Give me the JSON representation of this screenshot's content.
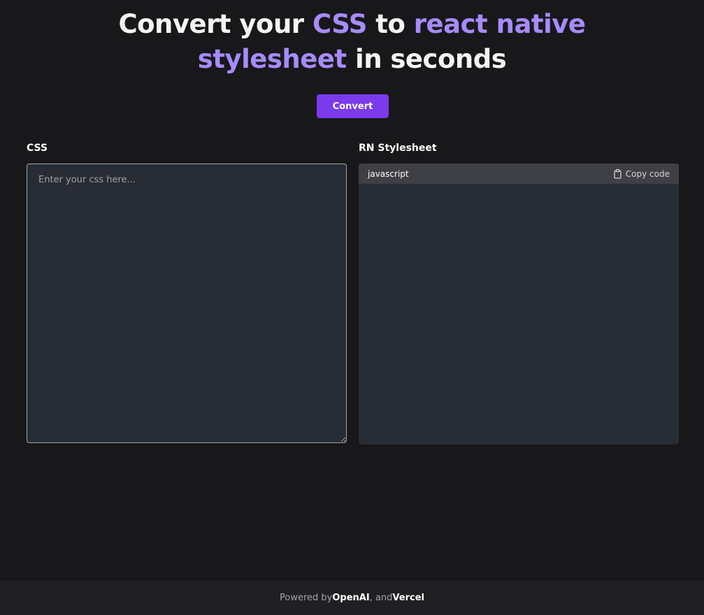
{
  "hero": {
    "w1": "Convert your ",
    "w2": "CSS",
    "w3": " to ",
    "w4": "react native",
    "w5": "stylesheet",
    "w6": " in seconds"
  },
  "actions": {
    "convert_label": "Convert"
  },
  "css_panel": {
    "label": "CSS",
    "placeholder": "Enter your css here..."
  },
  "rn_panel": {
    "label": "RN Stylesheet",
    "language": "javascript",
    "copy_label": "Copy code"
  },
  "footer": {
    "prefix": "Powered by ",
    "openai": "OpenAI",
    "sep": ", and ",
    "vercel": "Vercel"
  },
  "colors": {
    "background": "#18181b",
    "accent": "#a78bfa",
    "button": "#7c3aed",
    "editor": "#282c34"
  }
}
